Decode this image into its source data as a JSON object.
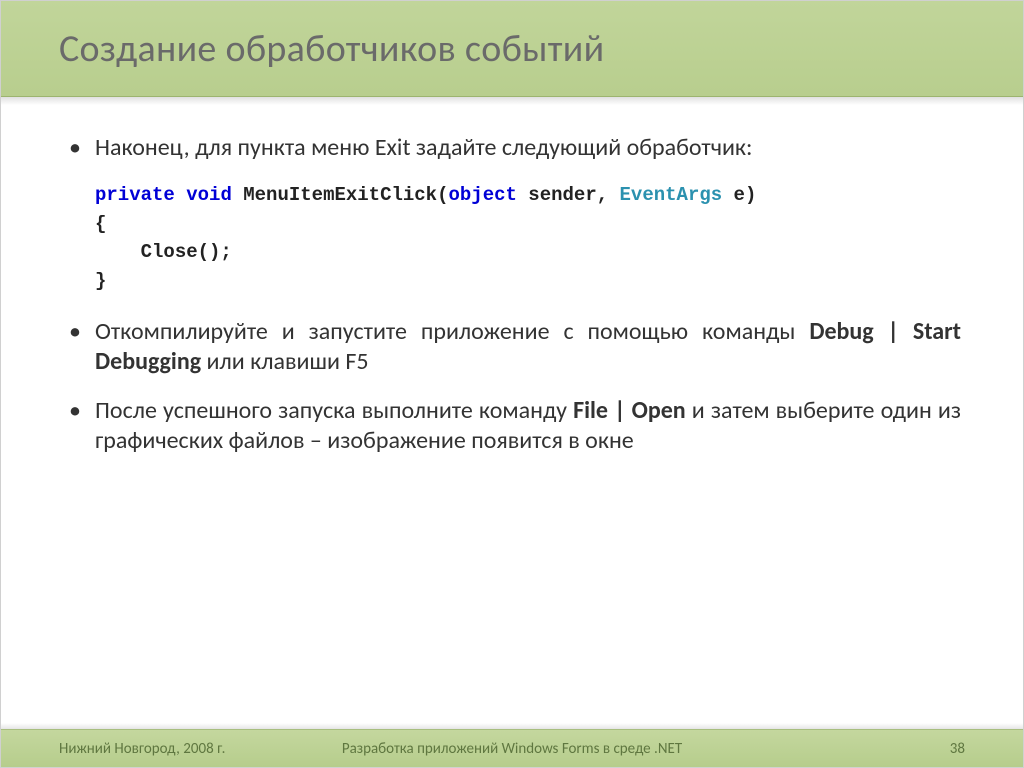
{
  "title": "Создание обработчиков событий",
  "bullets": {
    "b1": "Наконец, для пункта меню Exit задайте следующий обработчик:",
    "b2_pre": "Откомпилируйте и запустите приложение с помощью команды ",
    "b2_bold": "Debug | Start Debugging",
    "b2_post": " или клавиши F5",
    "b3_pre": "После успешного запуска выполните команду ",
    "b3_bold": "File | Open",
    "b3_post": " и затем выберите один из графических файлов – изображение появится в окне"
  },
  "code": {
    "l1": {
      "kw1": "private",
      "sp1": " ",
      "kw2": "void",
      "sp2": " ",
      "fn": "MenuItemExitClick(",
      "kw3": "object",
      "mid": " sender, ",
      "type": "EventArgs",
      "end": " e)"
    },
    "l2": "{",
    "l3": "    Close();",
    "l4": "}"
  },
  "footer": {
    "left": "Нижний Новгород, 2008 г.",
    "mid": "Разработка приложений Windows Forms в среде .NET",
    "right": "38"
  }
}
